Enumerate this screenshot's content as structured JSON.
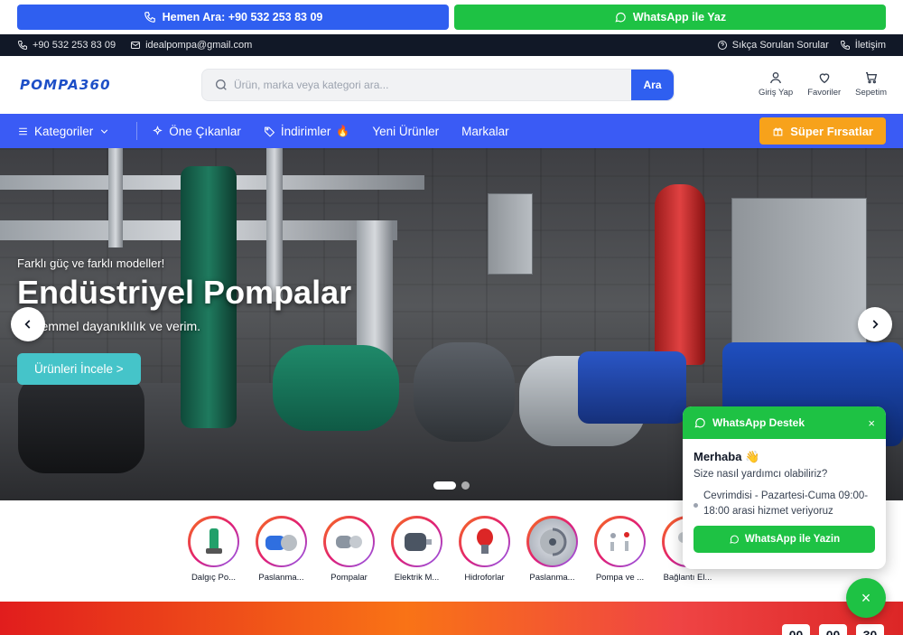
{
  "cta": {
    "call_label": "Hemen Ara: +90 532 253 83 09",
    "whatsapp_label": "WhatsApp ile Yaz"
  },
  "info": {
    "phone": "+90 532 253 83 09",
    "email": "idealpompa@gmail.com",
    "faq": "Sıkça Sorulan Sorular",
    "contact": "İletişim"
  },
  "header": {
    "logo": "POMPA360",
    "search_placeholder": "Ürün, marka veya kategori ara...",
    "search_button": "Ara",
    "actions": {
      "login": "Giriş Yap",
      "favorites": "Favoriler",
      "cart": "Sepetim"
    }
  },
  "nav": {
    "categories": "Kategoriler",
    "featured": "Öne Çıkanlar",
    "discounts": "İndirimler",
    "new_products": "Yeni Ürünler",
    "brands": "Markalar",
    "deals": "Süper Fırsatlar"
  },
  "hero": {
    "kicker": "Farklı güç ve farklı modeller!",
    "title": "Endüstriyel Pompalar",
    "subtitle": "Mükemmel dayanıklılık ve verim.",
    "button": "Ürünleri İncele >",
    "active_slide": 1,
    "slide_count": 2
  },
  "categories": [
    {
      "label": "Dalgıç Po...",
      "color": "#22a06b"
    },
    {
      "label": "Paslanma...",
      "color": "#2f6fe0"
    },
    {
      "label": "Pompalar",
      "color": "#8b95a1"
    },
    {
      "label": "Elektrik M...",
      "color": "#4b5563"
    },
    {
      "label": "Hidroforlar",
      "color": "#dc2626"
    },
    {
      "label": "Paslanma...",
      "color": "#9ca3af"
    },
    {
      "label": "Pompa ve ...",
      "color": "#b0b7bf"
    },
    {
      "label": "Bağlantı El...",
      "color": "#c2c7cc"
    }
  ],
  "promo": {
    "timer": [
      "00",
      "00",
      "30"
    ]
  },
  "whatsapp_widget": {
    "title": "WhatsApp Destek",
    "close": "×",
    "greeting": "Merhaba 👋",
    "question": "Size nasıl yardımcı olabiliriz?",
    "status": "Cevrimdisi - Pazartesi-Cuma 09:00-18:00 arasi hizmet veriyoruz",
    "button": "WhatsApp ile Yazin",
    "fab": "×"
  },
  "colors": {
    "primary": "#3a5bf5",
    "whatsapp": "#1ec244",
    "deal": "#f7a21b",
    "hero_button": "#45c4c9"
  }
}
